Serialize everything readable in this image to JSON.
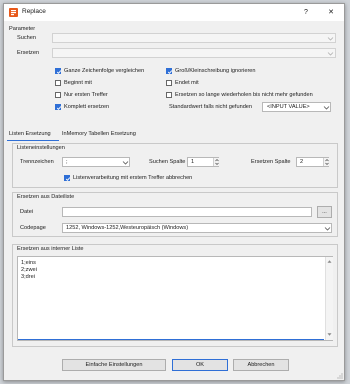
{
  "window": {
    "title": "Replace",
    "help_glyph": "?",
    "close_glyph": "✕"
  },
  "parameter": {
    "section_label": "Parameter",
    "search_label": "Suchen",
    "search_value": "",
    "replace_label": "Ersetzen",
    "replace_value": ""
  },
  "options": {
    "whole_string": {
      "label": "Ganze Zeichenfolge vergleichen",
      "checked": true
    },
    "case_insensitive": {
      "label": "Groß/Kleinschreibung ignorieren",
      "checked": true
    },
    "starts_with": {
      "label": "Beginnt mit",
      "checked": false
    },
    "ends_with": {
      "label": "Endet mit",
      "checked": false
    },
    "first_match_only": {
      "label": "Nur ersten Treffer",
      "checked": false
    },
    "repeat_replace": {
      "label": "Ersetzen so lange wiederholen bis nicht mehr gefunden",
      "checked": false
    },
    "replace_full": {
      "label": "Komplett ersetzen",
      "checked": true
    },
    "default_label": "Standardwert falls nicht gefunden",
    "default_value": "<INPUT VALUE>"
  },
  "tabs": [
    {
      "label": "Listen Ersetzung"
    },
    {
      "label": "InMemory Tabellen Ersetzung"
    }
  ],
  "list_settings": {
    "group_label": "Listeneinstellungen",
    "separator_label": "Trennzeichen",
    "separator_value": ";",
    "search_col_label": "Suchen Spalte",
    "search_col_value": "1",
    "replace_col_label": "Ersetzen Spalte",
    "replace_col_value": "2",
    "abort_label": "Listenverarbeitung mit erstem Treffer abbrechen",
    "abort_checked": true
  },
  "file_list": {
    "group_label": "Ersetzen aus Dateiliste",
    "file_label": "Datei",
    "file_value": "",
    "browse_label": "...",
    "codepage_label": "Codepage",
    "codepage_value": "1252, Windows-1252,Westeuropäisch (Windows)"
  },
  "internal_list": {
    "group_label": "Ersetzen aus interner Liste",
    "lines": [
      "1;eins",
      "2;zwei",
      "3;drei"
    ]
  },
  "footer": {
    "simple_label": "Einfache Einstellungen",
    "ok_label": "OK",
    "cancel_label": "Abbrechen"
  },
  "colors": {
    "accent": "#2f6fd6",
    "icon_orange": "#e8591a"
  }
}
